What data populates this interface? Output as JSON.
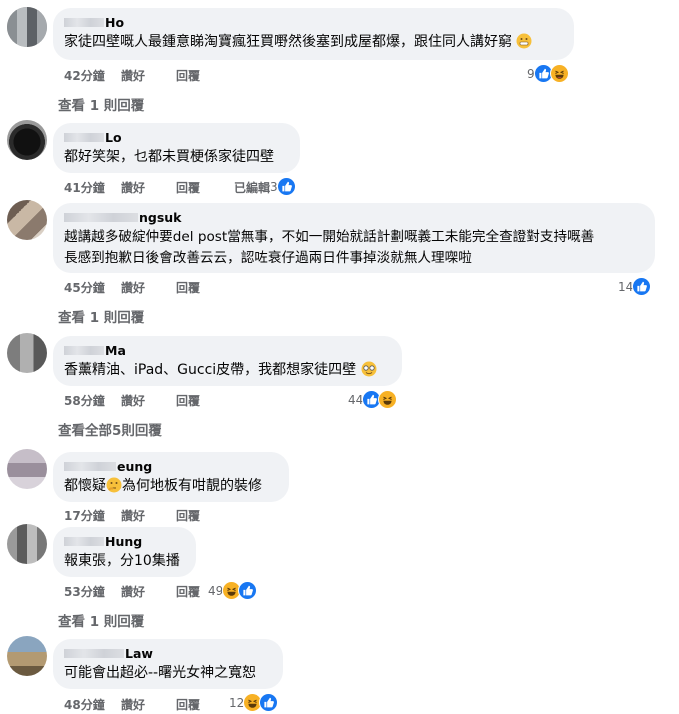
{
  "comments": [
    {
      "name": "Ho",
      "text": "家徒四壁嘅人最鍾意睇淘寶瘋狂買嘢然後塞到成屋都爆，跟住同人講好窮",
      "time": "42分鐘",
      "like": "讚好",
      "reply": "回覆",
      "edited": "",
      "count": "9",
      "reactions": [
        "like",
        "haha"
      ],
      "view_replies": "查看 1 則回覆"
    },
    {
      "name": "Lo",
      "text": "都好笑架，乜都未買梗係家徒四壁",
      "time": "41分鐘",
      "like": "讚好",
      "reply": "回覆",
      "edited": "已編輯",
      "count": "3",
      "reactions": [
        "like"
      ],
      "view_replies": ""
    },
    {
      "name": "ngsuk",
      "text": "越講越多破綻仲要del post當無事，不如一開始就話計劃嘅義工未能完全查證對支持嘅善",
      "text2": "長感到抱歉日後會改善云云，認咗衰仔過兩日件事掉淡就無人理㗎啦",
      "time": "45分鐘",
      "like": "讚好",
      "reply": "回覆",
      "edited": "",
      "count": "14",
      "reactions": [
        "like"
      ],
      "view_replies": "查看 1 則回覆"
    },
    {
      "name": "Ma",
      "text": "香薰精油、iPad、Gucci皮帶，我都想家徒四壁",
      "time": "58分鐘",
      "like": "讚好",
      "reply": "回覆",
      "edited": "",
      "count": "44",
      "reactions": [
        "like",
        "haha"
      ],
      "view_replies": "查看全部5則回覆"
    },
    {
      "name": "eung",
      "text_a": "都懷疑",
      "text_b": "為何地板有咁靚的裝修",
      "time": "17分鐘",
      "like": "讚好",
      "reply": "回覆",
      "edited": "",
      "count": "",
      "reactions": [],
      "view_replies": ""
    },
    {
      "name": "Hung",
      "text": "報東張，分10集播",
      "time": "53分鐘",
      "like": "讚好",
      "reply": "回覆",
      "edited": "",
      "count": "49",
      "reactions": [
        "haha",
        "like"
      ],
      "view_replies": "查看 1 則回覆"
    },
    {
      "name": "Law",
      "text": "可能會出超必--曙光女神之寬恕",
      "time": "48分鐘",
      "like": "讚好",
      "reply": "回覆",
      "edited": "",
      "count": "12",
      "reactions": [
        "haha",
        "like"
      ],
      "view_replies": ""
    }
  ],
  "colors": {
    "bubble": "#f0f2f5",
    "meta": "#65676b",
    "like_blue": "#1877f2",
    "haha_yellow": "#f7b125"
  },
  "icons": {
    "like": "thumbs-up-icon",
    "haha": "haha-emoji-icon"
  }
}
